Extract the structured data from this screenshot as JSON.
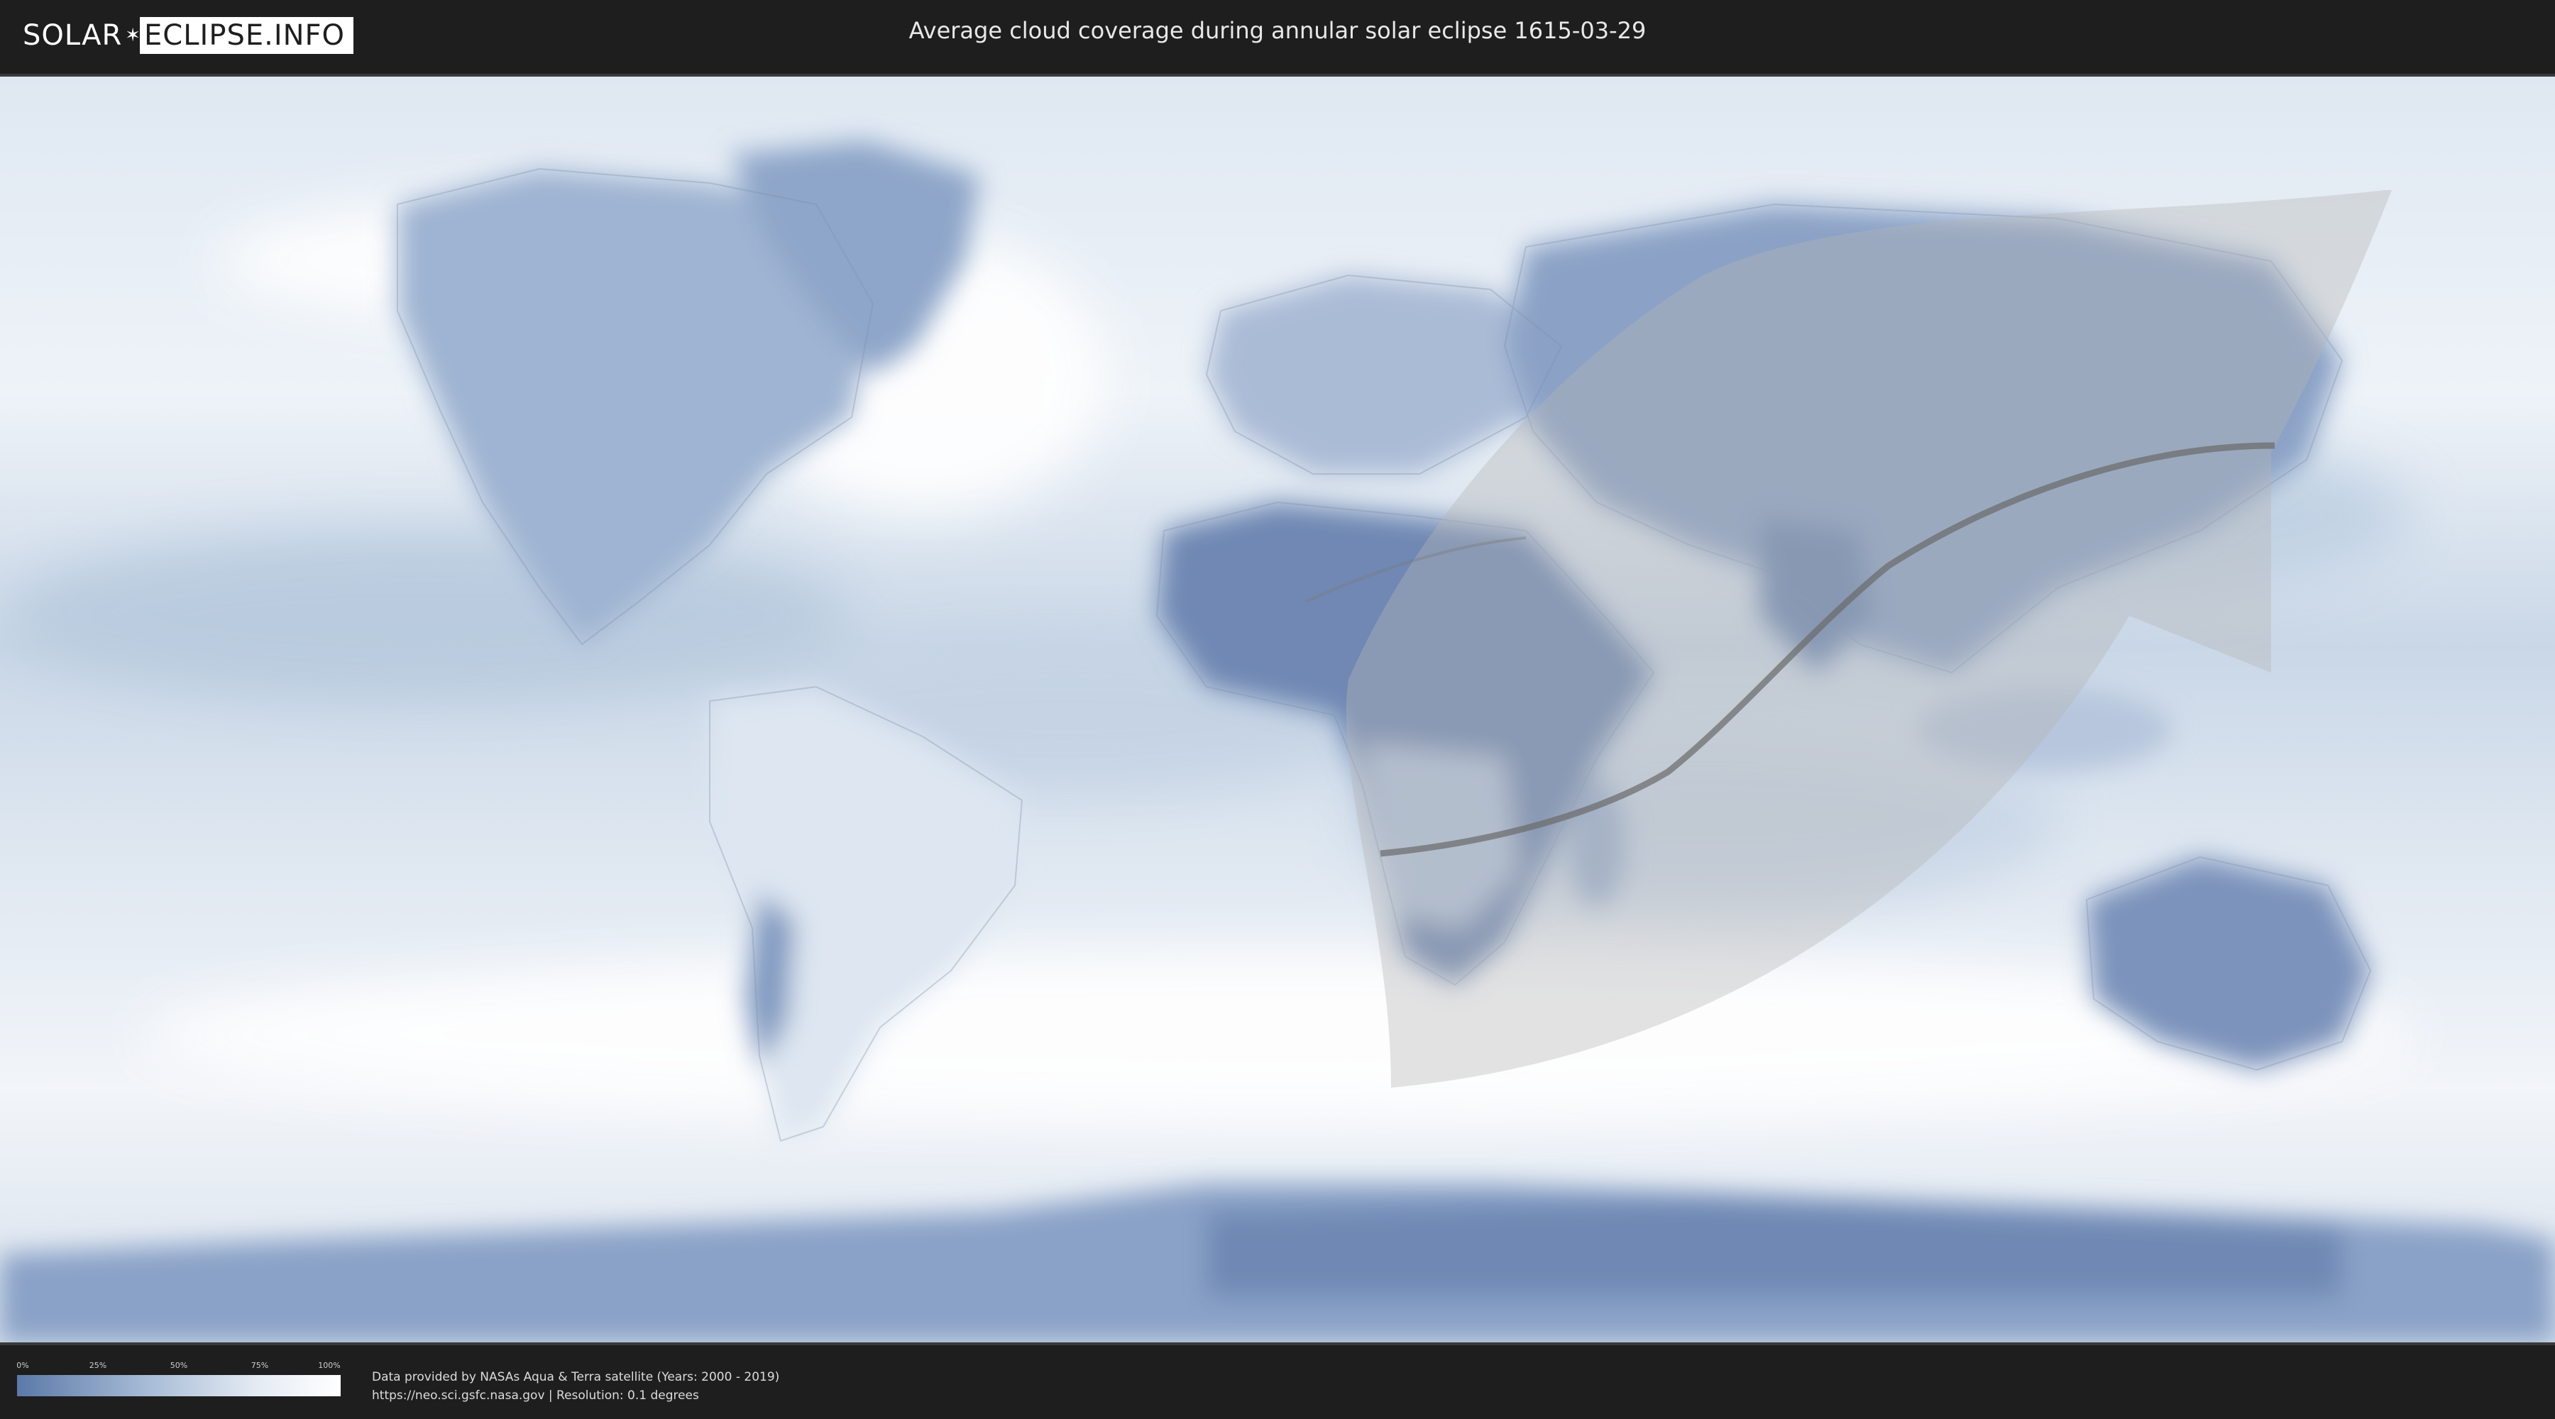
{
  "header": {
    "logo_left": "SOLAR",
    "logo_right": "ECLIPSE.INFO",
    "title": "Average cloud coverage during annular solar eclipse 1615-03-29"
  },
  "legend": {
    "ticks": [
      "0%",
      "25%",
      "50%",
      "75%",
      "100%"
    ],
    "color_low": "#5b79a8",
    "color_high": "#ffffff"
  },
  "credits": {
    "line1": "Data provided by NASAs Aqua & Terra satellite (Years: 2000 - 2019)",
    "line2": "https://neo.sci.gsfc.nasa.gov | Resolution: 0.1 degrees"
  },
  "colors": {
    "background": "#1e1e1e",
    "ocean_cloud": "#cfdcea",
    "land_clear": "#6f88b3",
    "eclipse_band": "#bdbdbd"
  }
}
